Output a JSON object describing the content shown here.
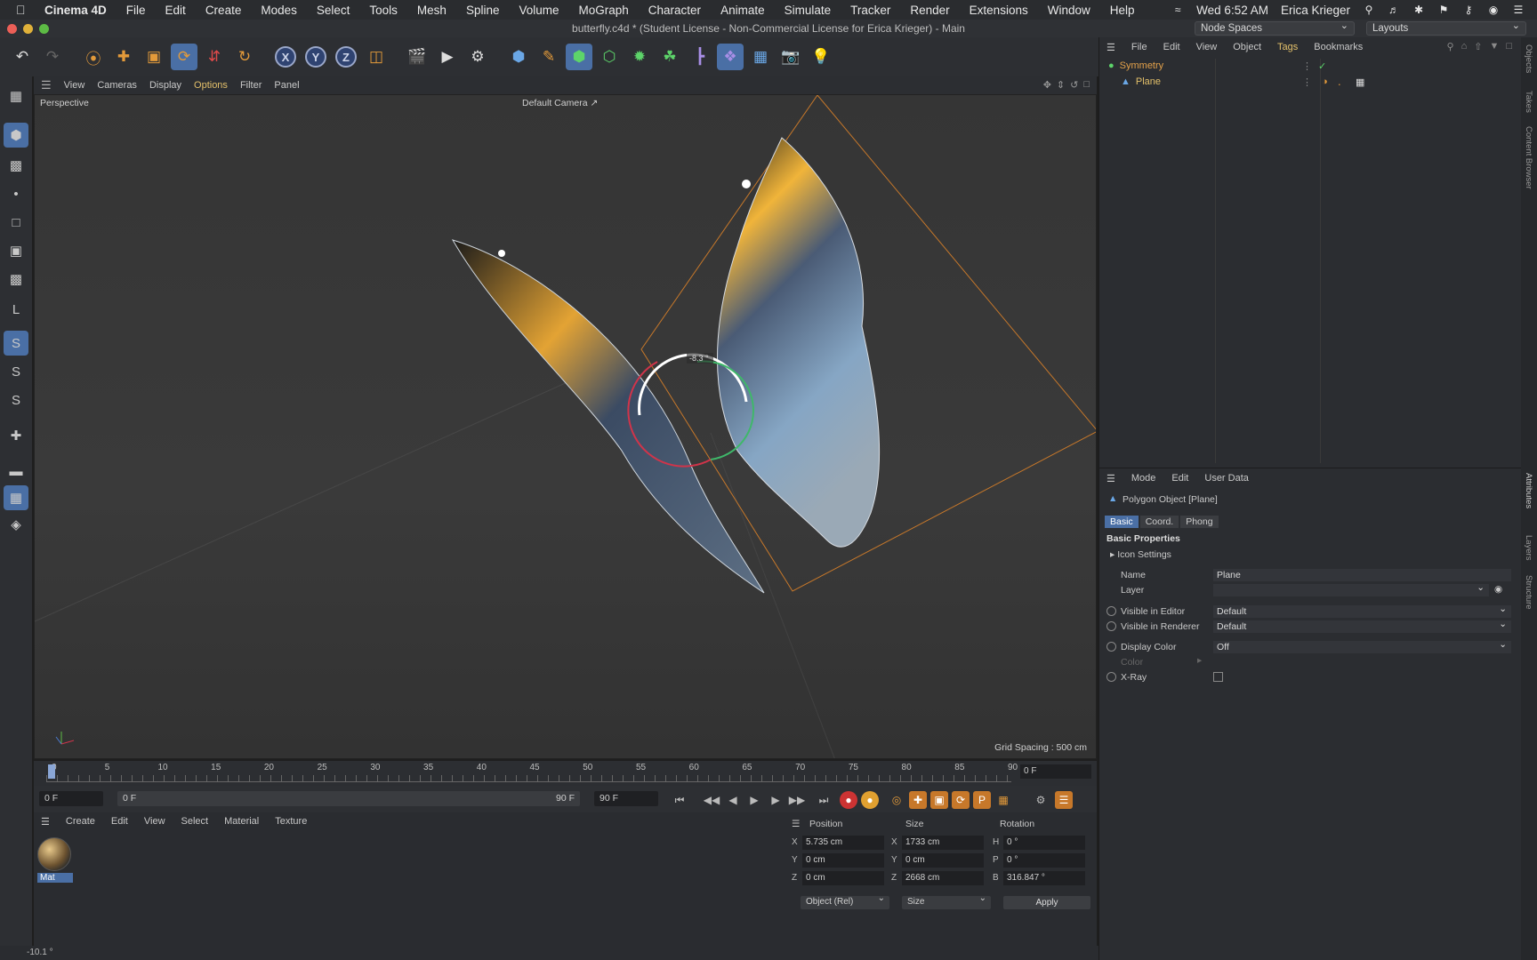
{
  "menubar": {
    "app": "Cinema 4D",
    "items": [
      "File",
      "Edit",
      "Create",
      "Modes",
      "Select",
      "Tools",
      "Mesh",
      "Spline",
      "Volume",
      "MoGraph",
      "Character",
      "Animate",
      "Simulate",
      "Tracker",
      "Render",
      "Extensions",
      "Window",
      "Help"
    ],
    "clock": "Wed 6:52 AM",
    "user": "Erica Krieger"
  },
  "window": {
    "title": "butterfly.c4d * (Student License - Non-Commercial License for Erica Krieger) - Main",
    "node_spaces": "Node Spaces",
    "layouts": "Layouts"
  },
  "viewport": {
    "menu": [
      "View",
      "Cameras",
      "Display",
      "Options",
      "Filter",
      "Panel"
    ],
    "label": "Perspective",
    "camera": "Default Camera",
    "grid_spacing": "Grid Spacing : 500 cm",
    "angle_readout": "-8.3 °"
  },
  "timeline": {
    "ticks": [
      "0",
      "5",
      "10",
      "15",
      "20",
      "25",
      "30",
      "35",
      "40",
      "45",
      "50",
      "55",
      "60",
      "65",
      "70",
      "75",
      "80",
      "85",
      "90"
    ],
    "current_frame": "0 F",
    "start": "0 F",
    "range_start": "0 F",
    "range_end": "90 F",
    "end": "90 F"
  },
  "material_manager": {
    "menu": [
      "Create",
      "Edit",
      "View",
      "Select",
      "Material",
      "Texture"
    ],
    "material_name": "Mat"
  },
  "coordinates": {
    "headers": {
      "position": "Position",
      "size": "Size",
      "rotation": "Rotation"
    },
    "position": {
      "x": "5.735 cm",
      "y": "0 cm",
      "z": "0 cm"
    },
    "size": {
      "x": "1733 cm",
      "y": "0 cm",
      "z": "2668 cm"
    },
    "rotation": {
      "h": "0 °",
      "p": "0 °",
      "b": "316.847 °"
    },
    "mode": "Object (Rel)",
    "size_mode": "Size",
    "apply": "Apply"
  },
  "status": "-10.1 °",
  "object_manager": {
    "menu": [
      "File",
      "Edit",
      "View",
      "Object",
      "Tags",
      "Bookmarks"
    ],
    "objects": [
      {
        "name": "Symmetry",
        "color": "#e3a14a"
      },
      {
        "name": "Plane",
        "color": "#e3c06a"
      }
    ]
  },
  "attribute_manager": {
    "menu": [
      "Mode",
      "Edit",
      "User Data"
    ],
    "object_title": "Polygon Object [Plane]",
    "tabs": [
      "Basic",
      "Coord.",
      "Phong"
    ],
    "section": "Basic Properties",
    "icon_settings": "Icon Settings",
    "fields": {
      "name_label": "Name",
      "name_value": "Plane",
      "layer_label": "Layer",
      "layer_value": "",
      "vis_editor_label": "Visible in Editor",
      "vis_editor_value": "Default",
      "vis_render_label": "Visible in Renderer",
      "vis_render_value": "Default",
      "display_color_label": "Display Color",
      "display_color_value": "Off",
      "color_label": "Color",
      "xray_label": "X-Ray"
    }
  },
  "right_strip": [
    "Objects",
    "Takes",
    "Content Browser",
    "Attributes",
    "Layers",
    "Structure"
  ],
  "colors": {
    "accent": "#4a6fa5",
    "selection_box": "#c7782a",
    "highlight_text": "#e3c06a"
  }
}
